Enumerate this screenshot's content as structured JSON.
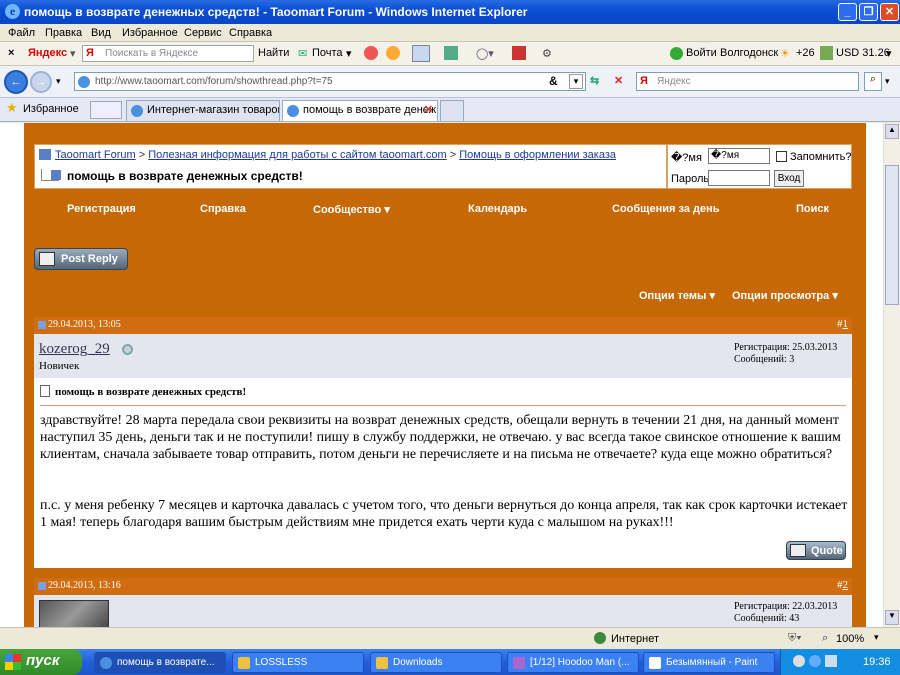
{
  "window": {
    "title": "помощь в возврате денежных средств! - Taoomart Forum - Windows Internet Explorer"
  },
  "menu": [
    "Файл",
    "Правка",
    "Вид",
    "Избранное",
    "Сервис",
    "Справка"
  ],
  "yandex_bar": {
    "close": "×",
    "brand": "Яндекс",
    "search_placeholder": "Поискать в Яндексе",
    "find": "Найти",
    "mail": "Почта",
    "login": "Войти",
    "city": "Волгодонск",
    "weather": "+26",
    "currency": "USD 31.26"
  },
  "address": {
    "url": "http://www.taoomart.com/forum/showthread.php?t=75",
    "search_placeholder": "Яндекс"
  },
  "tabs": {
    "favorites": "Избранное",
    "tab1": "Интернет-магазин товаров...",
    "tab2": "помощь в возврате денеж..."
  },
  "forum": {
    "breadcrumb": {
      "home": "Taoomart Forum",
      "sep1": " > ",
      "section": "Полезная информация для работы с сайтом taoomart.com",
      "sep2": " > ",
      "sub": "Помощь в оформлении заказа",
      "thread": "помощь в возврате денежных средств!"
    },
    "login": {
      "user_label": "�?мя",
      "user_value": "�?мя",
      "remember": "Запомнить?",
      "password_label": "Пароль",
      "submit": "Вход"
    },
    "nav": [
      "Регистрация",
      "Справка",
      "Сообщество",
      "Календарь",
      "Сообщения за день",
      "Поиск"
    ],
    "post_reply": "Post Reply",
    "thread_options": "Опции темы",
    "view_options": "Опции просмотра",
    "posts": [
      {
        "date": "29.04.2013, 13:05",
        "num_prefix": "#",
        "num": "1",
        "user": "kozerog_29",
        "rank": "Новичек",
        "reg": "Регистрация: 25.03.2013",
        "count": "Сообщений: 3",
        "title": "помощь в возврате денежных средств!",
        "p1": "здравствуйте! 28 марта передала свои реквизиты на возврат денежных средств, обещали вернуть в течении 21 дня, на данный момент наступил 35 день, деньги так и не поступили! пишу в службу поддержки, не отвечаю. у вас всегда такое свинское отношение к вашим клиентам, сначала забываете товар отправить, потом деньги не перечисляете и на письма не отвечаете? куда еще можно обратиться?",
        "p2": "п.с. у меня ребенку 7 месяцев и карточка давалась с учетом того, что деньги вернуться до конца апреля, так как срок карточки истекает 1 мая! теперь благодаря вашим быстрым действиям мне придется ехать черти куда с малышом на руках!!!",
        "quote": "Quote"
      },
      {
        "date": "29.04.2013, 13:16",
        "num_prefix": "#",
        "num": "2",
        "reg": "Регистрация: 22.03.2013",
        "count": "Сообщений: 43"
      }
    ]
  },
  "status": {
    "zone": "Интернет",
    "zoom": "100%"
  },
  "taskbar": {
    "start": "пуск",
    "items": [
      "помощь в возврате...",
      "LOSSLESS",
      "Downloads",
      "[1/12] Hoodoo Man (...",
      "Безымянный - Paint"
    ],
    "lang": "EN",
    "time": "19:36"
  }
}
